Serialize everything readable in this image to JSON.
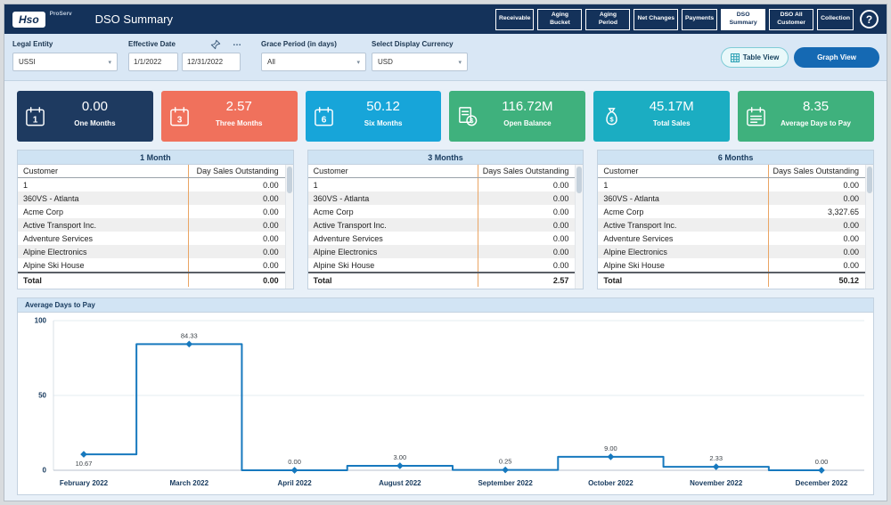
{
  "icons": {
    "chevron": "▾",
    "ellipsis": "…"
  },
  "header": {
    "logo": "Hso",
    "brand": "ProServ",
    "title": "DSO Summary",
    "help": "?",
    "nav": [
      {
        "label": "Receivable",
        "active": false
      },
      {
        "label": "Aging Bucket",
        "active": false
      },
      {
        "label": "Aging Period",
        "active": false
      },
      {
        "label": "Net Changes",
        "active": false
      },
      {
        "label": "Payments",
        "active": false
      },
      {
        "label": "DSO Summary",
        "active": true
      },
      {
        "label": "DSO All Customer",
        "active": false
      },
      {
        "label": "Collection",
        "active": false
      }
    ]
  },
  "filters": {
    "legal_entity": {
      "label": "Legal Entity",
      "value": "USSI"
    },
    "effective_date": {
      "label": "Effective Date",
      "from": "1/1/2022",
      "to": "12/31/2022"
    },
    "grace_period": {
      "label": "Grace Period (in days)",
      "value": "All"
    },
    "currency": {
      "label": "Select Display Currency",
      "value": "USD"
    },
    "view_buttons": {
      "table": "Table View",
      "graph": "Graph View"
    }
  },
  "kpis": [
    {
      "value": "0.00",
      "label": "One Months",
      "color": "#1e3a60",
      "icon": "calendar-1"
    },
    {
      "value": "2.57",
      "label": "Three Months",
      "color": "#f0715c",
      "icon": "calendar-3"
    },
    {
      "value": "50.12",
      "label": "Six Months",
      "color": "#17a5d9",
      "icon": "calendar-6"
    },
    {
      "value": "116.72M",
      "label": "Open Balance",
      "color": "#3fb17d",
      "icon": "invoice"
    },
    {
      "value": "45.17M",
      "label": "Total Sales",
      "color": "#1badc2",
      "icon": "sales"
    },
    {
      "value": "8.35",
      "label": "Average Days to Pay",
      "color": "#3fb17d",
      "icon": "calendar-lines"
    }
  ],
  "tables": [
    {
      "title": "1 Month",
      "columns": [
        "Customer",
        "Day Sales Outstanding"
      ],
      "rows": [
        [
          "1",
          "0.00"
        ],
        [
          "360VS - Atlanta",
          "0.00"
        ],
        [
          "Acme Corp",
          "0.00"
        ],
        [
          "Active Transport Inc.",
          "0.00"
        ],
        [
          "Adventure Services",
          "0.00"
        ],
        [
          "Alpine Electronics",
          "0.00"
        ],
        [
          "Alpine Ski House",
          "0.00"
        ]
      ],
      "total_label": "Total",
      "total_value": "0.00"
    },
    {
      "title": "3 Months",
      "columns": [
        "Customer",
        "Days Sales Outstanding"
      ],
      "rows": [
        [
          "1",
          "0.00"
        ],
        [
          "360VS - Atlanta",
          "0.00"
        ],
        [
          "Acme Corp",
          "0.00"
        ],
        [
          "Active Transport Inc.",
          "0.00"
        ],
        [
          "Adventure Services",
          "0.00"
        ],
        [
          "Alpine Electronics",
          "0.00"
        ],
        [
          "Alpine Ski House",
          "0.00"
        ]
      ],
      "total_label": "Total",
      "total_value": "2.57"
    },
    {
      "title": "6 Months",
      "columns": [
        "Customer",
        "Days Sales Outstanding"
      ],
      "rows": [
        [
          "1",
          "0.00"
        ],
        [
          "360VS - Atlanta",
          "0.00"
        ],
        [
          "Acme Corp",
          "3,327.65"
        ],
        [
          "Active Transport Inc.",
          "0.00"
        ],
        [
          "Adventure Services",
          "0.00"
        ],
        [
          "Alpine Electronics",
          "0.00"
        ],
        [
          "Alpine Ski House",
          "0.00"
        ]
      ],
      "total_label": "Total",
      "total_value": "50.12"
    }
  ],
  "chart_data": {
    "type": "line",
    "title": "Average Days to Pay",
    "x": [
      "February 2022",
      "March 2022",
      "April 2022",
      "August 2022",
      "September 2022",
      "October 2022",
      "November 2022",
      "December 2022"
    ],
    "values": [
      10.67,
      84.33,
      0,
      3,
      0.25,
      9,
      2.33,
      0
    ],
    "labels": [
      "10.67",
      "84.33",
      "0.00",
      "3.00",
      "0.25",
      "9.00",
      "2.33",
      "0.00"
    ],
    "label_position": [
      "below",
      "above",
      "above",
      "above",
      "above",
      "above",
      "above",
      "above"
    ],
    "ylim": [
      0,
      100
    ],
    "yticks": [
      0,
      50,
      100
    ],
    "step": "mid",
    "grid": true,
    "legend": false,
    "line_color": "#1779be"
  }
}
